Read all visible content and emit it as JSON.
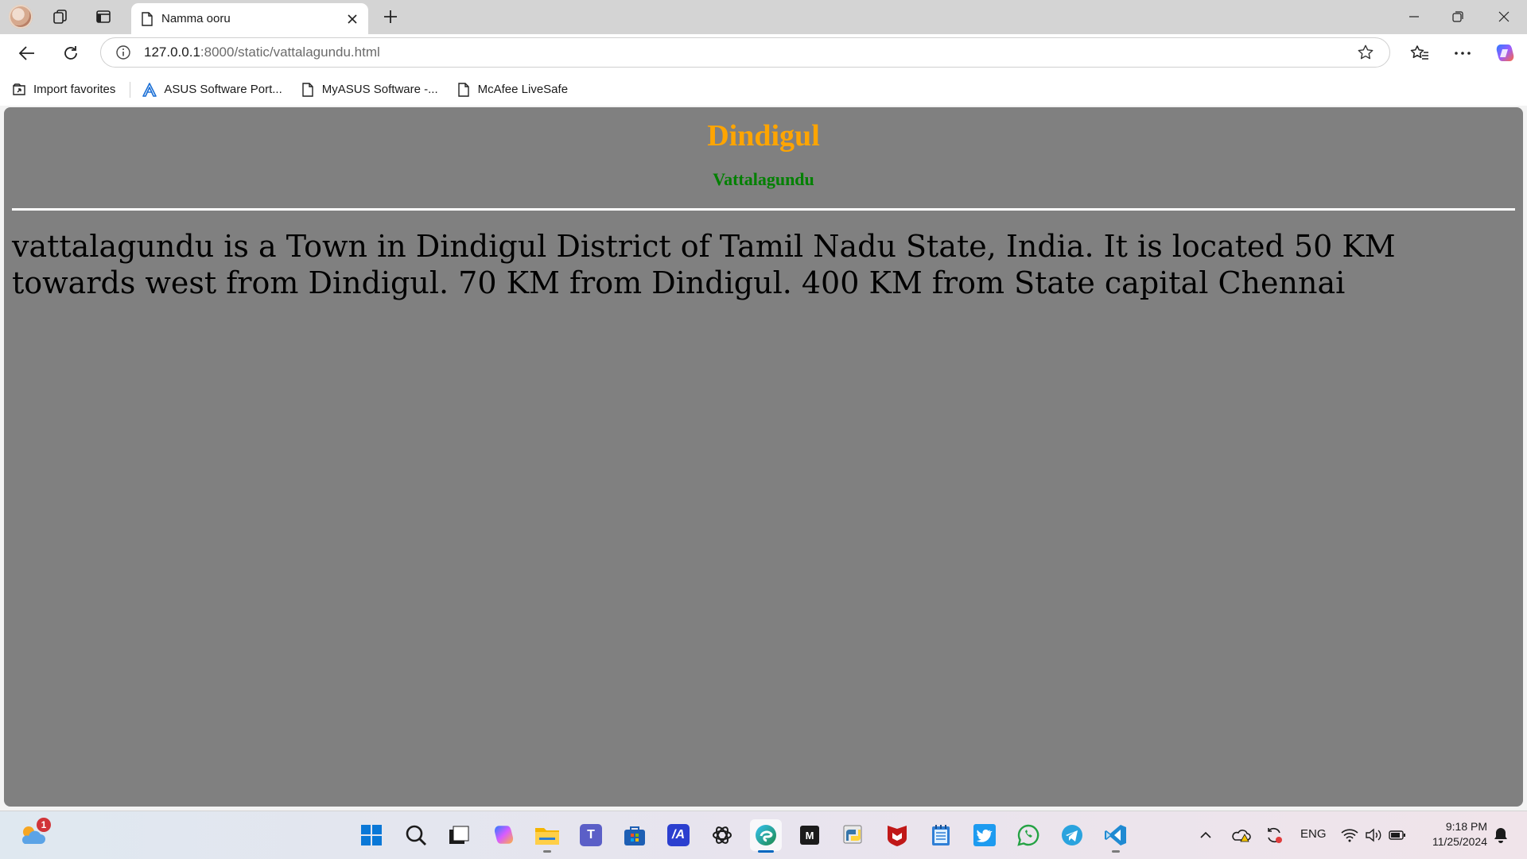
{
  "browser": {
    "tab": {
      "title": "Namma ooru"
    },
    "address": {
      "host": "127.0.0.1",
      "path": ":8000/static/vattalagundu.html"
    },
    "favorites": [
      {
        "label": "Import favorites",
        "icon": "import-icon"
      },
      {
        "label": "ASUS Software Port...",
        "icon": "asus-icon"
      },
      {
        "label": "MyASUS Software -...",
        "icon": "page-icon"
      },
      {
        "label": "McAfee LiveSafe",
        "icon": "page-icon"
      }
    ]
  },
  "page": {
    "heading": "Dindigul",
    "subheading": "Vattalagundu",
    "paragraph": "vattalagundu is a Town in Dindigul District of Tamil Nadu State, India. It is located 50 KM towards west from Dindigul. 70 KM from Dindigul. 400 KM from State capital Chennai",
    "colors": {
      "background": "#808080",
      "heading": "#ffa500",
      "subheading": "#008000"
    }
  },
  "taskbar": {
    "weather_badge": "1",
    "apps": [
      "start-icon",
      "search-icon",
      "task-view-icon",
      "copilot-icon",
      "file-explorer-icon",
      "teams-icon",
      "store-icon",
      "math-app-icon",
      "chatgpt-icon",
      "edge-icon",
      "m-app-icon",
      "python-icon",
      "mcafee-icon",
      "notepad-icon",
      "twitter-icon",
      "whatsapp-icon",
      "telegram-icon",
      "vscode-icon"
    ],
    "language": "ENG",
    "time": "9:18 PM",
    "date": "11/25/2024"
  }
}
